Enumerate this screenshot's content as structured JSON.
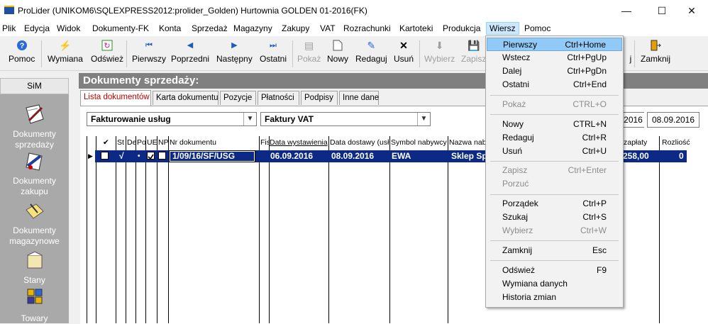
{
  "window": {
    "title": "ProLider  (UNIKOM6\\SQLEXPRESS2012:prolider_Golden) Hurtownia GOLDEN 01-2016(FK)",
    "minimize": "—",
    "maximize": "☐",
    "close": "✕"
  },
  "menubar": [
    "Plik",
    "Edycja",
    "Widok",
    "Dokumenty-FK",
    "Konta",
    "Sprzedaż",
    "Magazyny",
    "Zakupy",
    "VAT",
    "Rozrachunki",
    "Kartoteki",
    "Produkcja",
    "Wiersz",
    "Pomoc"
  ],
  "toolbar": {
    "pomoc": "Pomoc",
    "wymiana": "Wymiana",
    "odswiez": "Odśwież",
    "pierwszy": "Pierwszy",
    "poprzedni": "Poprzedni",
    "nastepny": "Następny",
    "ostatni": "Ostatni",
    "pokaz": "Pokaż",
    "nowy": "Nowy",
    "redaguj": "Redaguj",
    "usun": "Usuń",
    "wybierz": "Wybierz",
    "zapisz": "Zapisz",
    "j": "j",
    "zamknij": "Zamknij"
  },
  "sidebar": {
    "header": "SiM",
    "items": [
      {
        "label": "Dokumenty sprzedaży",
        "icon": "document-edit-icon"
      },
      {
        "label": "Dokumenty zakupu",
        "icon": "purchase-document-icon"
      },
      {
        "label": "Dokumenty magazynowe",
        "icon": "warehouse-document-icon"
      },
      {
        "label": "Stany",
        "icon": "stock-icon"
      },
      {
        "label": "Towary",
        "icon": "goods-icon"
      }
    ]
  },
  "panel": {
    "title": "Dokumenty sprzedaży:",
    "tabs": [
      "Lista dokumentów",
      "Karta dokumentu",
      "Pozycje",
      "Płatności",
      "Podpisy",
      "Inne dane"
    ],
    "filter1": "Fakturowanie usług",
    "filter2": "Faktury VAT",
    "date_from": "2016",
    "date_to": "08.09.2016"
  },
  "grid": {
    "headers": [
      "✔",
      "St",
      "De",
      "Po",
      "UE",
      "NP",
      "Nr dokumentu",
      "Fis",
      "Data wystawienia",
      "Data dostawy (usł",
      "Symbol nabywcy",
      "Nazwa nab",
      "zapłaty",
      "Rozliość"
    ],
    "row": {
      "status": "√",
      "de": "•",
      "nr": "1/09/16/SF/USG",
      "data_wyst": "06.09.2016",
      "data_dost": "08.09.2016",
      "symbol": "EWA",
      "nazwa": "Sklep Sp",
      "zaplaty": "258,00",
      "rozl": "0"
    }
  },
  "dropdown": {
    "items": [
      {
        "label": "Pierwszy",
        "shortcut": "Ctrl+Home",
        "enabled": true,
        "highlighted": true
      },
      {
        "label": "Wstecz",
        "shortcut": "Ctrl+PgUp",
        "enabled": true
      },
      {
        "label": "Dalej",
        "shortcut": "Ctrl+PgDn",
        "enabled": true
      },
      {
        "label": "Ostatni",
        "shortcut": "Ctrl+End",
        "enabled": true
      },
      {
        "label": "Pokaż",
        "shortcut": "CTRL+O",
        "enabled": false
      },
      {
        "label": "Nowy",
        "shortcut": "CTRL+N",
        "enabled": true
      },
      {
        "label": "Redaguj",
        "shortcut": "Ctrl+R",
        "enabled": true
      },
      {
        "label": "Usuń",
        "shortcut": "Ctrl+U",
        "enabled": true
      },
      {
        "label": "Zapisz",
        "shortcut": "Ctrl+Enter",
        "enabled": false
      },
      {
        "label": "Porzuć",
        "shortcut": "",
        "enabled": false
      },
      {
        "label": "Porządek",
        "shortcut": "Ctrl+P",
        "enabled": true
      },
      {
        "label": "Szukaj",
        "shortcut": "Ctrl+S",
        "enabled": true
      },
      {
        "label": "Wybierz",
        "shortcut": "Ctrl+W",
        "enabled": false
      },
      {
        "label": "Zamknij",
        "shortcut": "Esc",
        "enabled": true
      },
      {
        "label": "Odśwież",
        "shortcut": "F9",
        "enabled": true
      },
      {
        "label": "Wymiana danych",
        "shortcut": "",
        "enabled": true
      },
      {
        "label": "Historia zmian",
        "shortcut": "",
        "enabled": true
      }
    ]
  },
  "colors": {
    "selection": "#0c2a85",
    "sidebar": "#a9a9a9",
    "panel_header": "#808080",
    "menu_highlight": "#91c9f7"
  }
}
